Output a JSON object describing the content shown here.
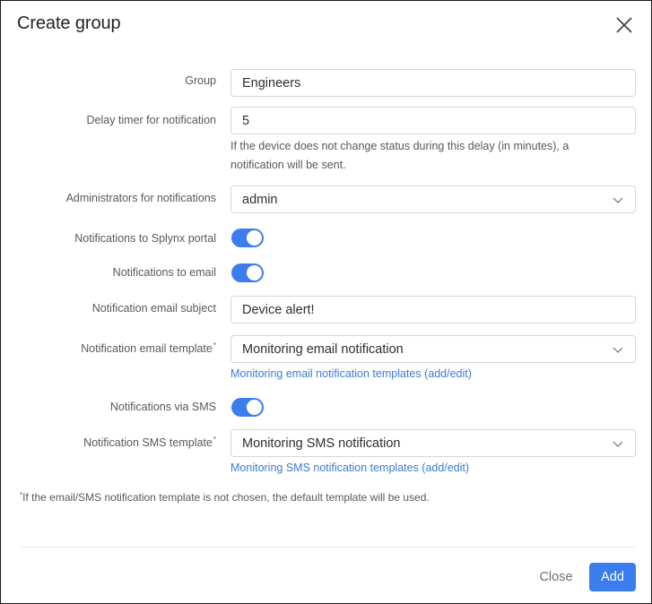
{
  "dialog": {
    "title": "Create group",
    "close_icon": "close-x-icon"
  },
  "form": {
    "group": {
      "label": "Group",
      "value": "Engineers"
    },
    "delay": {
      "label": "Delay timer for notification",
      "value": "5",
      "help": "If the device does not change status during this delay (in minutes), a notification will be sent."
    },
    "administrators": {
      "label": "Administrators for notifications",
      "value": "admin"
    },
    "portal_toggle": {
      "label": "Notifications to Splynx portal",
      "enabled": true
    },
    "email_toggle": {
      "label": "Notifications to email",
      "enabled": true
    },
    "email_subject": {
      "label": "Notification email subject",
      "value": "Device alert!"
    },
    "email_template": {
      "label": "Notification email template",
      "marker": "*",
      "value": "Monitoring email notification",
      "link": "Monitoring email notification templates (add/edit)"
    },
    "sms_toggle": {
      "label": "Notifications via SMS",
      "enabled": true
    },
    "sms_template": {
      "label": "Notification SMS template",
      "marker": "*",
      "value": "Monitoring SMS notification",
      "link": "Monitoring SMS notification templates (add/edit)"
    }
  },
  "footnote": {
    "marker": "*",
    "text": "If the email/SMS notification template is not chosen, the default template will be used."
  },
  "footer": {
    "close_label": "Close",
    "add_label": "Add"
  },
  "colors": {
    "accent": "#3b7ded",
    "link": "#3a7bd5"
  }
}
